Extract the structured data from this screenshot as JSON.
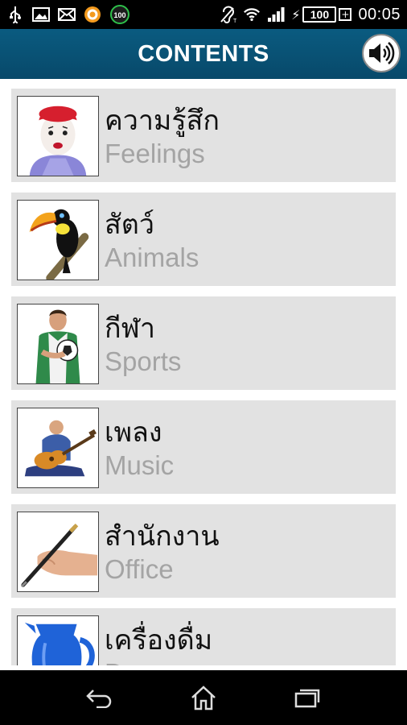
{
  "status_bar": {
    "icons": [
      "usb-icon",
      "image-icon",
      "mail-icon",
      "app-notification-icon",
      "score-100-icon",
      "hearing-aid-icon",
      "wifi-icon",
      "signal-icon"
    ],
    "badge_text": "100",
    "battery_level": "100",
    "battery_charging": true,
    "time": "00:05"
  },
  "header": {
    "title": "CONTENTS",
    "sound_button_icon": "speaker-icon"
  },
  "categories": [
    {
      "thai": "ความรู้สึก",
      "english": "Feelings",
      "image": "mime-face"
    },
    {
      "thai": "สัตว์",
      "english": "Animals",
      "image": "toucan"
    },
    {
      "thai": "กีฬา",
      "english": "Sports",
      "image": "soccer-player"
    },
    {
      "thai": "เพลง",
      "english": "Music",
      "image": "guitarist"
    },
    {
      "thai": "สำนักงาน",
      "english": "Office",
      "image": "hand-with-pen"
    },
    {
      "thai": "เครื่องดื่ม",
      "english": "D",
      "image": "blue-jug"
    }
  ],
  "nav_bar": {
    "back": "back-icon",
    "home": "home-icon",
    "recents": "recent-apps-icon"
  },
  "colors": {
    "header_bg": "#0a5b80",
    "item_bg": "#e2e2e2",
    "english_text": "#a4a4a4"
  }
}
